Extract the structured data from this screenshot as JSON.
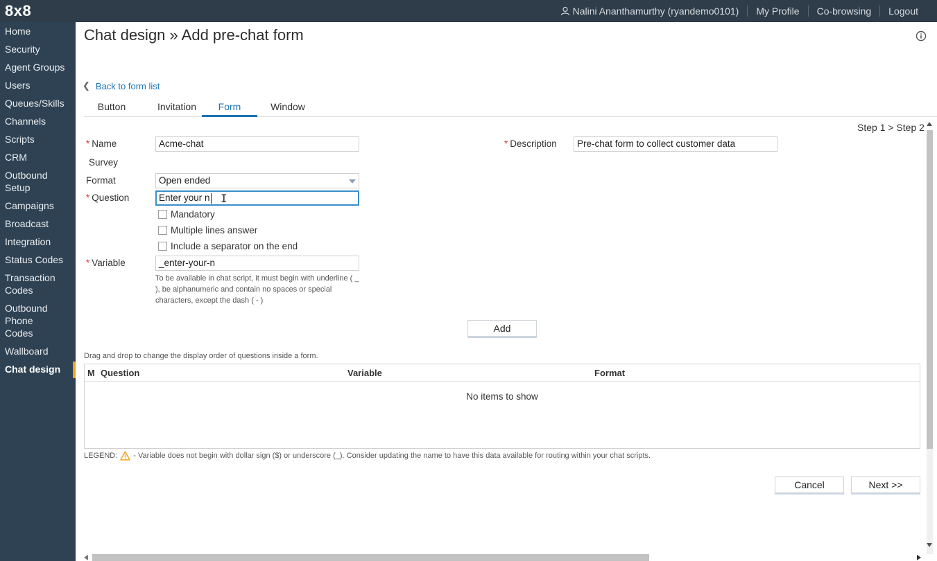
{
  "app": {
    "logo": "8x8"
  },
  "topbar": {
    "user": "Nalini Ananthamurthy (ryandemo0101)",
    "links": [
      "My Profile",
      "Co-browsing",
      "Logout"
    ]
  },
  "sidebar": {
    "items": [
      {
        "label": "Home"
      },
      {
        "label": "Security"
      },
      {
        "label": "Agent Groups"
      },
      {
        "label": "Users"
      },
      {
        "label": "Queues/Skills"
      },
      {
        "label": "Channels"
      },
      {
        "label": "Scripts"
      },
      {
        "label": "CRM"
      },
      {
        "label": "Outbound Setup"
      },
      {
        "label": "Campaigns"
      },
      {
        "label": "Broadcast"
      },
      {
        "label": "Integration"
      },
      {
        "label": "Status Codes"
      },
      {
        "label": "Transaction Codes"
      },
      {
        "label": "Outbound Phone Codes"
      },
      {
        "label": "Wallboard"
      },
      {
        "label": "Chat design"
      }
    ],
    "active": "Chat design"
  },
  "page": {
    "title": "Chat design » Add pre-chat form",
    "back_link": "Back to form list",
    "step": "Step 1 > Step 2"
  },
  "tabs": [
    {
      "label": "Button"
    },
    {
      "label": "Invitation"
    },
    {
      "label": "Form",
      "active": true
    },
    {
      "label": "Window"
    }
  ],
  "form": {
    "name_label": "Name",
    "name_value": "Acme-chat",
    "description_label": "Description",
    "description_value": "Pre-chat form to collect customer data",
    "survey_label": "Survey",
    "format_label": "Format",
    "format_value": "Open ended",
    "question_label": "Question",
    "question_value": "Enter your n",
    "mandatory_label": "Mandatory",
    "multiline_label": "Multiple lines answer",
    "separator_label": "Include a separator on the end",
    "variable_label": "Variable",
    "variable_value": "_enter-your-n",
    "variable_help": "To be available in chat script, it must begin with underline ( _ ), be alphanumeric and contain no spaces or special characters, except the dash ( - )",
    "add_button": "Add",
    "required_mark": "*"
  },
  "grid": {
    "hint": "Drag and drop to change the display order of questions inside a form.",
    "columns": [
      "M",
      "Question",
      "Variable",
      "Format"
    ],
    "empty_text": "No items to show"
  },
  "legend": {
    "label": "LEGEND:",
    "text": "- Variable does not begin with dollar sign ($) or underscore (_). Consider updating the name to have this data available for routing within your chat scripts."
  },
  "actions": {
    "cancel": "Cancel",
    "next": "Next >>"
  },
  "colors": {
    "topbar": "#2f3d4a",
    "sidebar": "#2f4254",
    "accent": "#1a73b5",
    "active_marker": "#f0a21a",
    "required": "#dd3333",
    "warning": "#f0a21a"
  }
}
